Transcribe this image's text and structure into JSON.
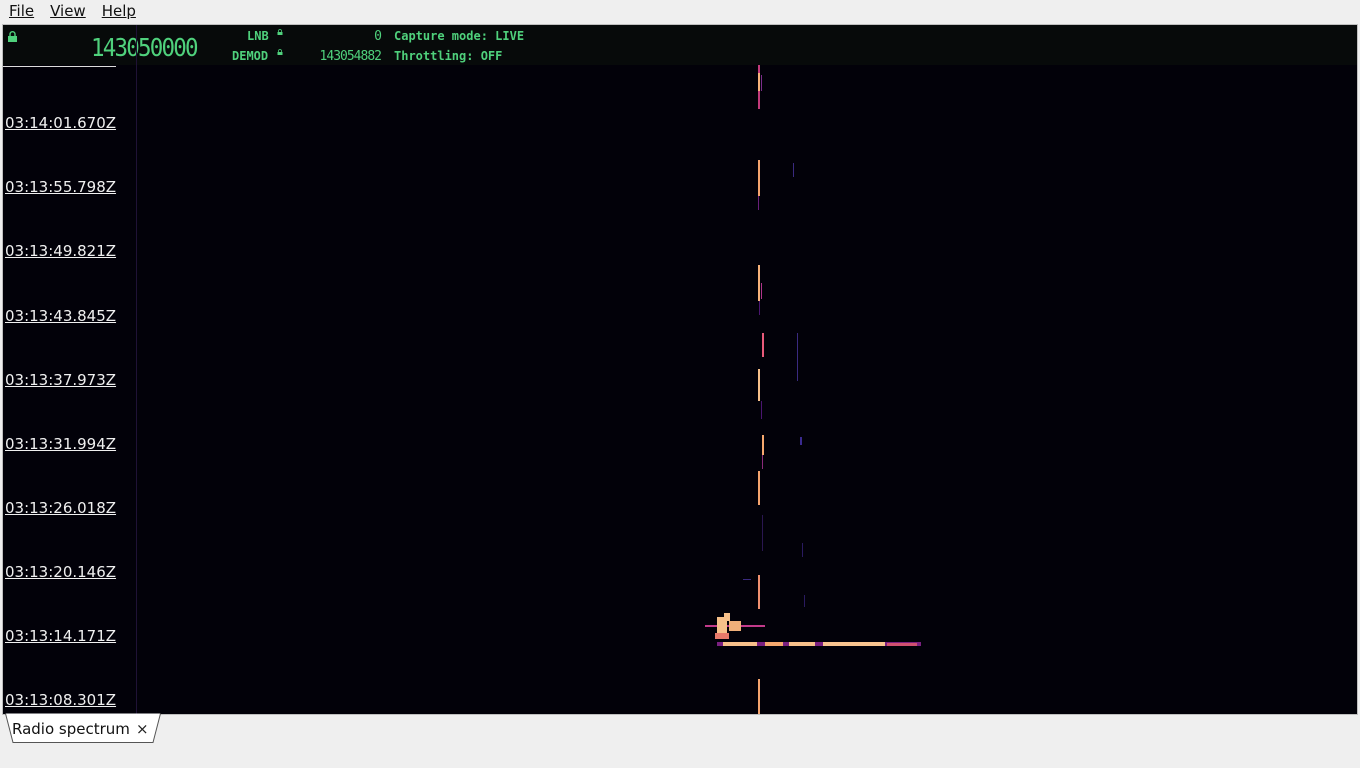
{
  "menu": {
    "file": "File",
    "view": "View",
    "help": "Help"
  },
  "hud": {
    "frequency": "143050000",
    "lnb_label": "LNB",
    "lnb_value": "0",
    "demod_label": "DEMOD",
    "demod_value": "143054882",
    "capture_mode": "Capture mode: LIVE",
    "throttling": "Throttling: OFF",
    "accent_color": "#4fd17c"
  },
  "timestamps": [
    "03:14:01.670Z",
    "03:13:55.798Z",
    "03:13:49.821Z",
    "03:13:43.845Z",
    "03:13:37.973Z",
    "03:13:31.994Z",
    "03:13:26.018Z",
    "03:13:20.146Z",
    "03:13:14.171Z",
    "03:13:08.301Z"
  ],
  "tab": {
    "label": "Radio spectrum",
    "close": "×"
  }
}
